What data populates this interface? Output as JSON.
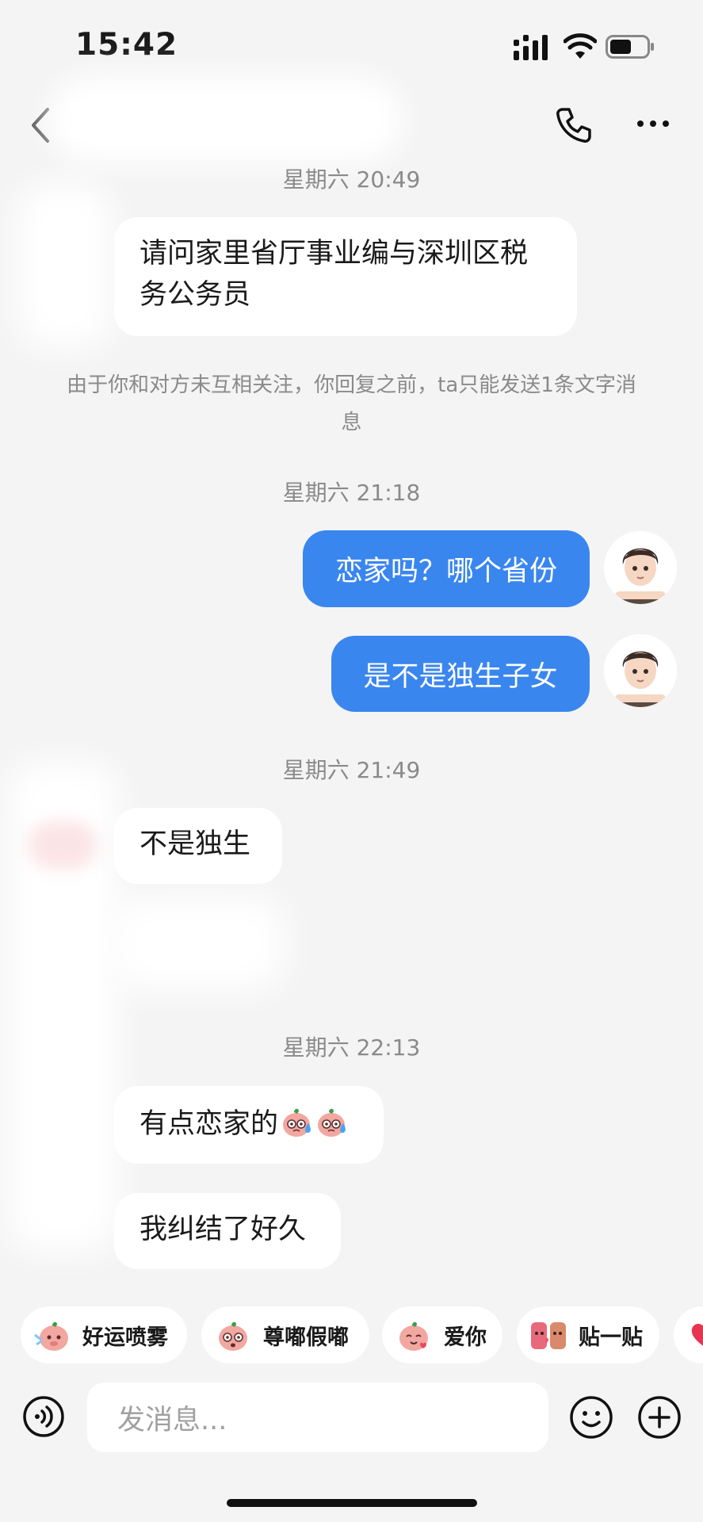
{
  "status": {
    "time": "15:42"
  },
  "messages": {
    "ts1": "星期六 20:49",
    "m1": "请问家里省厅事业编与深圳区税务公务员",
    "notice": "由于你和对方未互相关注，你回复之前，ta只能发送1条文字消息",
    "ts2": "星期六 21:18",
    "m2": "恋家吗？哪个省份",
    "m3": "是不是独生子女",
    "ts3": "星期六 21:49",
    "m4": "不是独生",
    "ts4": "星期六 22:13",
    "m5": "有点恋家的",
    "m6": "我纠结了好久"
  },
  "stickers": [
    "好运喷雾",
    "尊嘟假嘟",
    "爱你",
    "贴一贴"
  ],
  "input": {
    "placeholder": "发消息..."
  },
  "colors": {
    "accent": "#3a86ef",
    "background": "#f4f4f5",
    "bubble_in": "#ffffff"
  },
  "icons": [
    "back-icon",
    "phone-icon",
    "more-icon",
    "voice-icon",
    "emoji-icon",
    "plus-icon"
  ]
}
